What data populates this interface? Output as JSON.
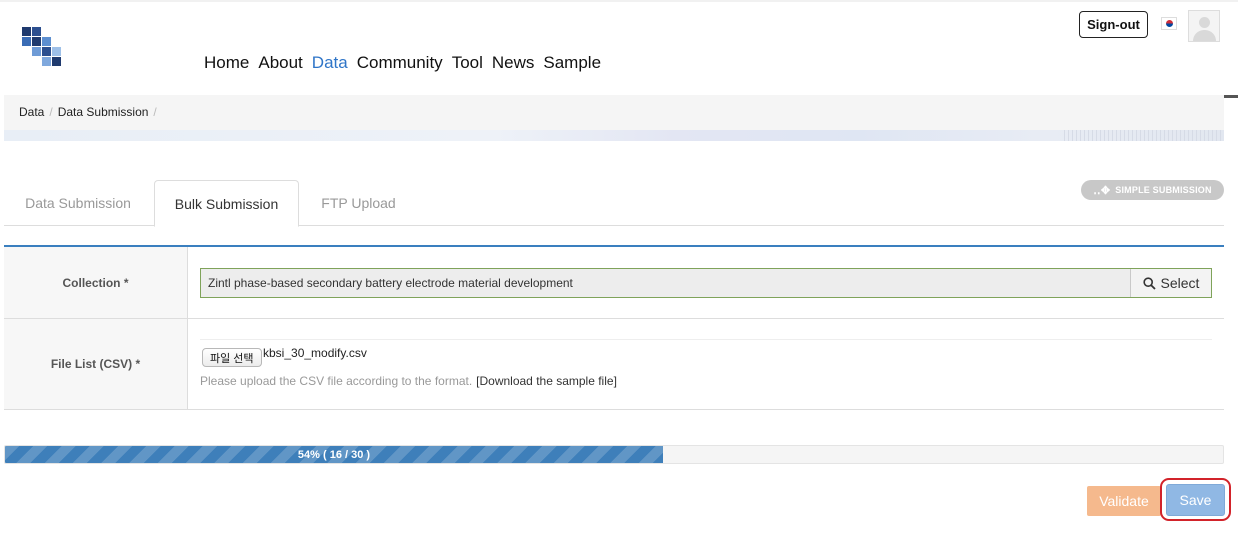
{
  "header": {
    "nav": [
      "Home",
      "About",
      "Data",
      "Community",
      "Tool",
      "News",
      "Sample"
    ],
    "active_nav": "Data",
    "signout_label": "Sign-out"
  },
  "breadcrumb": [
    "Data",
    "Data Submission"
  ],
  "tabs": [
    {
      "label": "Data Submission",
      "active": false
    },
    {
      "label": "Bulk Submission",
      "active": true
    },
    {
      "label": "FTP Upload",
      "active": false
    }
  ],
  "simple_submission_label": "SIMPLE SUBMISSION",
  "form": {
    "collection_label": "Collection *",
    "collection_value": "Zintl phase-based secondary battery electrode material development",
    "select_label": "Select",
    "file_list_label": "File List (CSV) *",
    "file_button_label": "파일 선택",
    "file_name": "kbsi_30_modify.csv",
    "help_text": "Please upload the CSV file according to the format.",
    "sample_link": "[Download the sample file]"
  },
  "progress": {
    "fraction": 0.54,
    "text": "54% ( 16 / 30 )"
  },
  "actions": {
    "validate_label": "Validate",
    "save_label": "Save"
  },
  "colors": {
    "accent": "#2f75c8",
    "progress_bar": "#3e7fba",
    "validate": "#f5b98d",
    "save": "#90b8e4",
    "highlight_ring": "#d2232a"
  }
}
